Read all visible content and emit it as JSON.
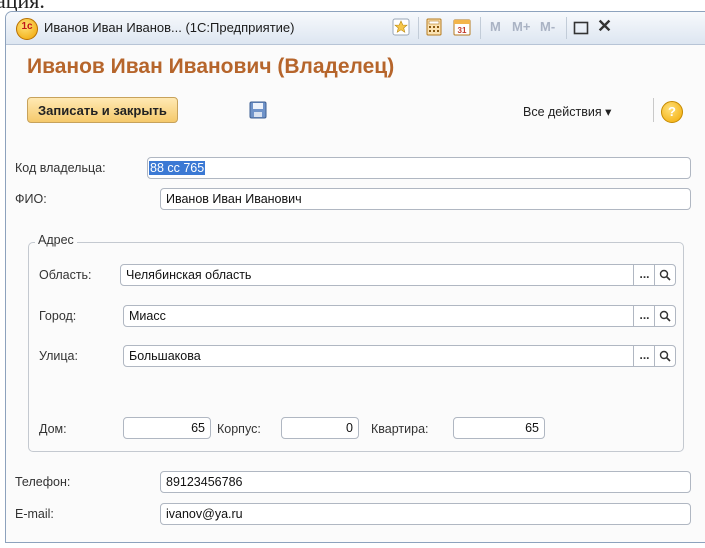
{
  "top_text": "ация.",
  "window": {
    "app_icon": "1c-logo-icon",
    "app_icon_label": "1c",
    "title": "Иванов Иван Иванов... (1С:Предприятие)",
    "toolbar": {
      "favorites_icon": "star-icon",
      "calculator_icon": "calculator-icon",
      "calendar_icon": "calendar-icon",
      "calendar_day": "31",
      "m_label": "M",
      "mplus_label": "M+",
      "mminus_label": "M-"
    }
  },
  "form": {
    "title": "Иванов Иван Иванович (Владелец)",
    "save_close_label": "Записать и закрыть",
    "all_actions_label": "Все действия ▾",
    "help_label": "?",
    "owner_code": {
      "label": "Код владельца:",
      "value": "88 сс 765"
    },
    "fio": {
      "label": "ФИО:",
      "value": "Иванов Иван Иванович"
    },
    "address": {
      "group_label": "Адрес",
      "region": {
        "label": "Область:",
        "value": "Челябинская область"
      },
      "city": {
        "label": "Город:",
        "value": "Миасс"
      },
      "street": {
        "label": "Улица:",
        "value": "Большакова"
      },
      "house": {
        "label": "Дом:",
        "value": "65"
      },
      "building": {
        "label": "Корпус:",
        "value": "0"
      },
      "apartment": {
        "label": "Квартира:",
        "value": "65"
      },
      "choose_label": "...",
      "search_label": "🔍"
    },
    "phone": {
      "label": "Телефон:",
      "value": "89123456786"
    },
    "email": {
      "label": "E-mail:",
      "value": "ivanov@ya.ru"
    }
  },
  "colors": {
    "title": "#b6652b",
    "button": "#f5c96b",
    "selection": "#3b79d4"
  }
}
